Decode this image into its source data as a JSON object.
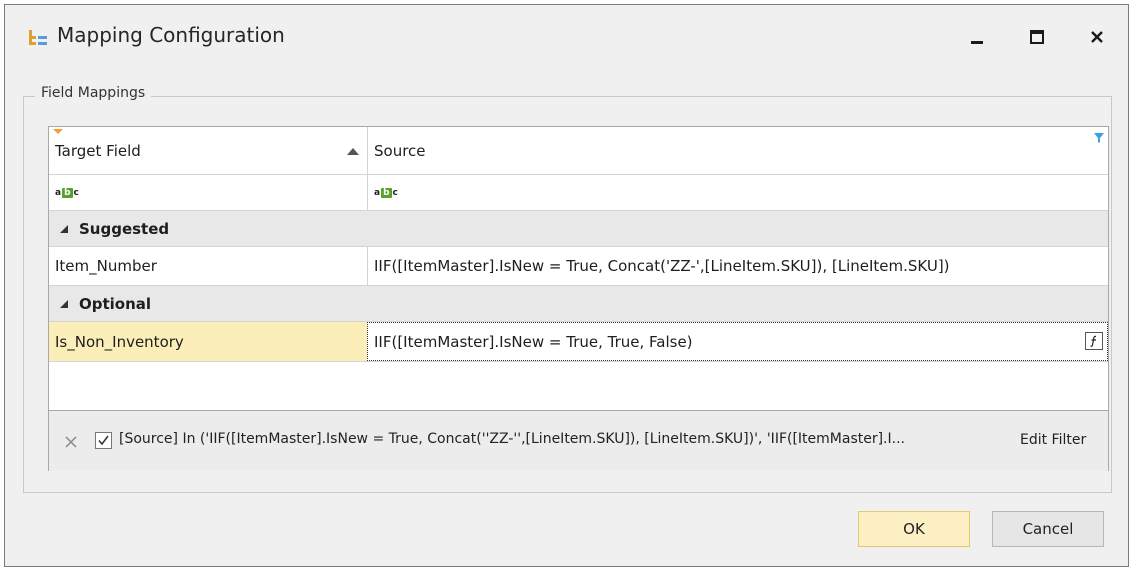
{
  "window": {
    "title": "Mapping Configuration",
    "controls": {
      "minimize": "minimize",
      "maximize": "maximize",
      "close": "close"
    }
  },
  "group": {
    "legend": "Field Mappings"
  },
  "grid": {
    "columns": [
      {
        "header": "Target Field",
        "sort": "ascending"
      },
      {
        "header": "Source"
      }
    ],
    "groups": [
      {
        "label": "Suggested",
        "rows": [
          {
            "target": "Item_Number",
            "source": "IIF([ItemMaster].IsNew = True, Concat('ZZ-',[LineItem.SKU]), [LineItem.SKU])"
          }
        ]
      },
      {
        "label": "Optional",
        "rows": [
          {
            "target": "Is_Non_Inventory",
            "source": "IIF([ItemMaster].IsNew = True, True, False)"
          }
        ]
      }
    ],
    "filter_panel": {
      "text": "[Source] In ('IIF([ItemMaster].IsNew = True, Concat(''ZZ-'',[LineItem.SKU]), [LineItem.SKU])', 'IIF([ItemMaster].I...",
      "edit_label": "Edit Filter",
      "enabled": true
    }
  },
  "buttons": {
    "ok": "OK",
    "cancel": "Cancel"
  },
  "colors": {
    "focused_row": "#fbeeb8",
    "ok_button": "#fcefc3",
    "abc_icon": "#5aa02c",
    "filter_icon": "#3aa0e8",
    "sort_marker": "#f0a030"
  }
}
